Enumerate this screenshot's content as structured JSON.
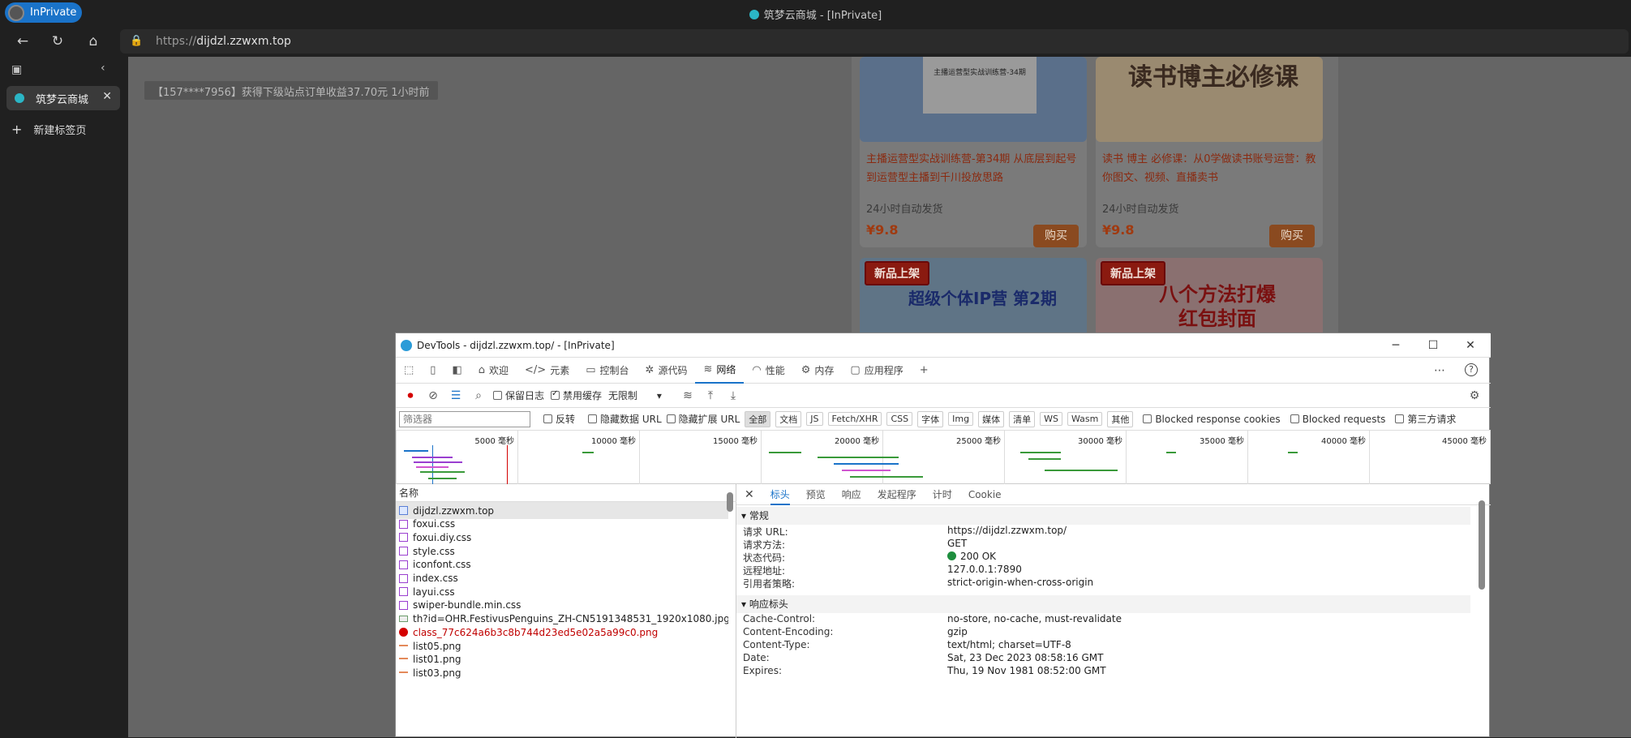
{
  "browser": {
    "inprivate_label": "InPrivate",
    "window_title": "筑梦云商城 - [InPrivate]",
    "url_proto": "https://",
    "url_host": "dijdzl.zzwxm.top",
    "tab_title": "筑梦云商城",
    "new_tab": "新建标签页"
  },
  "page": {
    "notice": "【157****7956】获得下级站点订单收益37.70元 1小时前",
    "products": [
      {
        "img_text": "主播运营型实战训练营-34期",
        "title": "主播运营型实战训练营-第34期 从底层到起号到运营型主播到千川投放思路",
        "ship": "24小时自动发货",
        "price": "¥9.8",
        "buy": "购买"
      },
      {
        "img_text": "读书博主必修课",
        "title": "读书 博主 必修课：从0学做读书账号运营：教你图文、视频、直播卖书",
        "ship": "24小时自动发货",
        "price": "¥9.8",
        "buy": "购买"
      }
    ],
    "new_badges": [
      "新品上架",
      "新品上架"
    ],
    "card3_text": "超级个体IP营 第2期",
    "card4_text": "八个方法打爆 红包封面"
  },
  "devtools": {
    "title": "DevTools - dijdzl.zzwxm.top/ - [InPrivate]",
    "tabs": [
      "欢迎",
      "元素",
      "控制台",
      "源代码",
      "网络",
      "性能",
      "内存",
      "应用程序"
    ],
    "toolbar": {
      "preserve_log": "保留日志",
      "disable_cache": "禁用缓存",
      "throttle": "无限制"
    },
    "filter": {
      "placeholder": "筛选器",
      "invert": "反转",
      "hide_data": "隐藏数据 URL",
      "hide_ext": "隐藏扩展 URL",
      "types": [
        "全部",
        "文档",
        "JS",
        "Fetch/XHR",
        "CSS",
        "字体",
        "Img",
        "媒体",
        "清单",
        "WS",
        "Wasm",
        "其他"
      ],
      "blocked_cookies": "Blocked response cookies",
      "blocked_requests": "Blocked requests",
      "third_party": "第三方请求"
    },
    "timeline_ticks": [
      "5000 毫秒",
      "10000 毫秒",
      "15000 毫秒",
      "20000 毫秒",
      "25000 毫秒",
      "30000 毫秒",
      "35000 毫秒",
      "40000 毫秒",
      "45000 毫秒"
    ],
    "list_header": "名称",
    "requests": [
      {
        "name": "dijdzl.zzwxm.top",
        "type": "doc"
      },
      {
        "name": "foxui.css",
        "type": "css"
      },
      {
        "name": "foxui.diy.css",
        "type": "css"
      },
      {
        "name": "style.css",
        "type": "css"
      },
      {
        "name": "iconfont.css",
        "type": "css"
      },
      {
        "name": "index.css",
        "type": "css"
      },
      {
        "name": "layui.css",
        "type": "css"
      },
      {
        "name": "swiper-bundle.min.css",
        "type": "css"
      },
      {
        "name": "th?id=OHR.FestivusPenguins_ZH-CN5191348531_1920x1080.jpg&rf=...",
        "type": "img"
      },
      {
        "name": "class_77c624a6b3c8b744d23ed5e02a5a99c0.png",
        "type": "err"
      },
      {
        "name": "list05.png",
        "type": "png"
      },
      {
        "name": "list01.png",
        "type": "png"
      },
      {
        "name": "list03.png",
        "type": "png"
      }
    ],
    "detail_tabs": [
      "标头",
      "预览",
      "响应",
      "发起程序",
      "计时",
      "Cookie"
    ],
    "general_title": "常规",
    "general": [
      {
        "k": "请求 URL:",
        "v": "https://dijdzl.zzwxm.top/"
      },
      {
        "k": "请求方法:",
        "v": "GET"
      },
      {
        "k": "状态代码:",
        "v": "200 OK"
      },
      {
        "k": "远程地址:",
        "v": "127.0.0.1:7890"
      },
      {
        "k": "引用者策略:",
        "v": "strict-origin-when-cross-origin"
      }
    ],
    "response_title": "响应标头",
    "response": [
      {
        "k": "Cache-Control:",
        "v": "no-store, no-cache, must-revalidate"
      },
      {
        "k": "Content-Encoding:",
        "v": "gzip"
      },
      {
        "k": "Content-Type:",
        "v": "text/html; charset=UTF-8"
      },
      {
        "k": "Date:",
        "v": "Sat, 23 Dec 2023 08:58:16 GMT"
      },
      {
        "k": "Expires:",
        "v": "Thu, 19 Nov 1981 08:52:00 GMT"
      }
    ]
  },
  "colors": {
    "accent": "#1a73c9",
    "status_ok": "#1e8e3e",
    "error": "#c00000"
  }
}
